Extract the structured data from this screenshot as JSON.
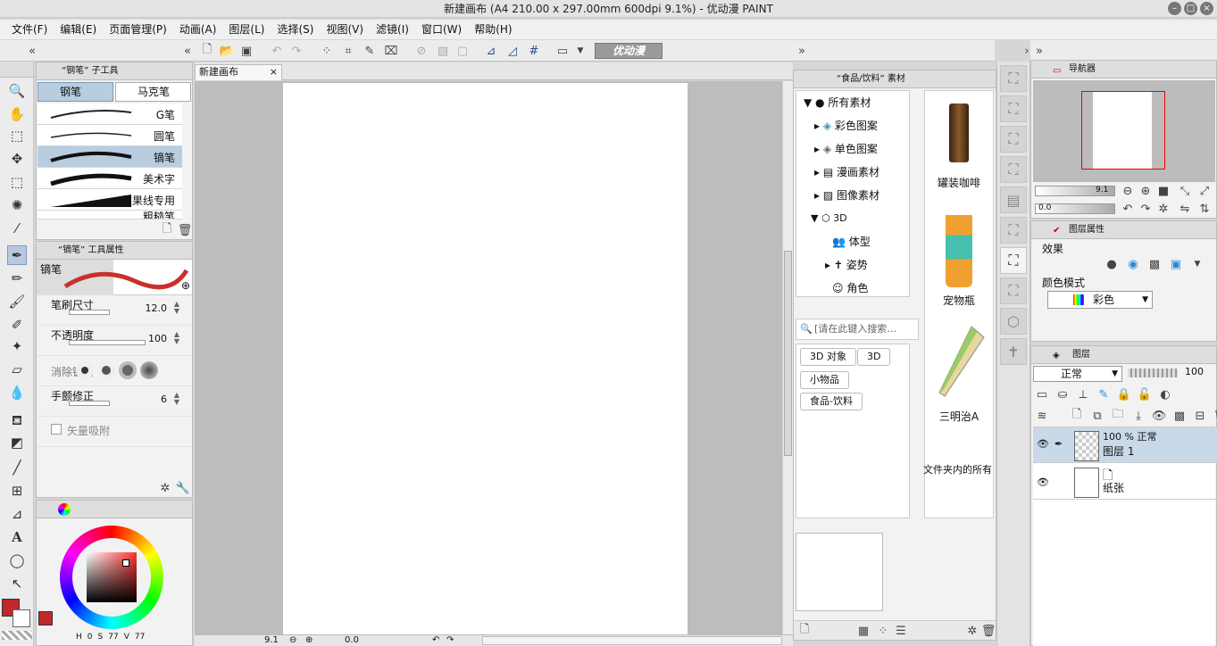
{
  "window": {
    "title": "新建画布 (A4 210.00 x 297.00mm 600dpi 9.1%) - 优动漫 PAINT"
  },
  "menu": [
    "文件(F)",
    "编辑(E)",
    "页面管理(P)",
    "动画(A)",
    "图层(L)",
    "选择(S)",
    "视图(V)",
    "滤镜(I)",
    "窗口(W)",
    "帮助(H)"
  ],
  "toolbar": {
    "logo": "优动漫"
  },
  "canvas_tab": {
    "label": "新建画布",
    "close": "×"
  },
  "subtool": {
    "tab": "“钢笔” 子工具",
    "groups": [
      "钢笔",
      "马克笔"
    ],
    "brushes": [
      "G笔",
      "圆笔",
      "镝笔",
      "美术字",
      "效果线专用",
      "粗糙笔"
    ],
    "selected": "镝笔"
  },
  "props": {
    "tab": "“镝笔” 工具属性",
    "name": "镝笔",
    "size_label": "笔刷尺寸",
    "size_value": "12.0",
    "opacity_label": "不透明度",
    "opacity_value": "100",
    "aa_label": "消除锯齿",
    "stab_label": "手颤修正",
    "stab_value": "6",
    "vector_label": "矢量吸附"
  },
  "color": {
    "main_hex": "#c0282a",
    "sub_hex": "#ffffff",
    "hue_square_hex": "#8c2c2c",
    "readout": [
      "H",
      "0",
      "S",
      "77",
      "V",
      "77"
    ]
  },
  "statusbar": {
    "zoom": "9.1",
    "angle": "0.0"
  },
  "material": {
    "tab": "“食品/饮料” 素材",
    "tree": [
      "所有素材",
      "彩色图案",
      "单色图案",
      "漫画素材",
      "图像素材",
      "3D",
      "体型",
      "姿势",
      "角色"
    ],
    "search_placeholder": "[请在此键入搜索…",
    "tags": [
      "3D 对象",
      "3D",
      "小物品",
      "食品-饮料"
    ],
    "items": [
      "罐装咖啡",
      "宠物瓶",
      "三明治A"
    ],
    "footer_note": "文件夹内的所有"
  },
  "navigator": {
    "tab": "导航器",
    "zoom": "9.1",
    "angle": "0.0"
  },
  "layer_props": {
    "tab": "图层属性",
    "effect_label": "效果",
    "color_mode_label": "颜色模式",
    "color_mode_value": "彩色"
  },
  "layers": {
    "tab": "图层",
    "blend": "正常",
    "opacity": "100",
    "rows": [
      {
        "top": "100 % 正常",
        "name": "图层 1"
      },
      {
        "top": "",
        "name": "纸张"
      }
    ]
  }
}
